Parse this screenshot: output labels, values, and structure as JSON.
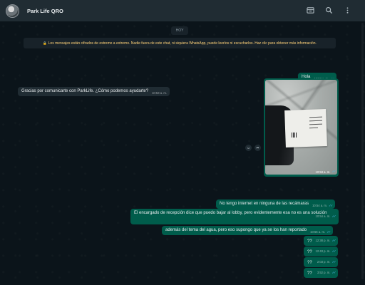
{
  "header": {
    "contact_name": "Park Life QRO",
    "icons": [
      "avatar",
      "catalog-icon",
      "search-icon",
      "menu-icon"
    ]
  },
  "chat": {
    "date_label": "HOY",
    "encryption_notice": "Los mensajes están cifrados de extremo a extremo. Nadie fuera de este chat, ni siquiera WhatsApp, puede leerlos ni escucharlos. Haz clic para obtener más información.",
    "messages": [
      {
        "direction": "out",
        "text": "Hola",
        "time": "10:53 a. m.",
        "status": "read"
      },
      {
        "direction": "in",
        "text": "Gracias por comunicarte con ParkLife. ¿Cómo podemos ayudarte?",
        "time": "10:53 a. m."
      },
      {
        "direction": "out",
        "type": "image",
        "text": "",
        "time": "10:53 a. m.",
        "status": "read"
      },
      {
        "direction": "out",
        "text": "No tengo internet en ninguna de las recámaras",
        "time": "10:54 a. m.",
        "status": "read"
      },
      {
        "direction": "out",
        "text": "El encargado de recepción dice que puedo bajar al lobby, pero evidentemente esa no es una solución",
        "time": "10:54 a. m.",
        "status": "read"
      },
      {
        "direction": "out",
        "text": "además del tema del agua, pero eso supongo que ya se los han reportado",
        "time": "10:56 a. m.",
        "status": "read"
      },
      {
        "direction": "out",
        "text": "??",
        "time": "12:38 p. m.",
        "status": "read"
      },
      {
        "direction": "out",
        "text": "??",
        "time": "12:43 p. m.",
        "status": "read"
      },
      {
        "direction": "out",
        "text": "??",
        "time": "2:03 p. m.",
        "status": "read"
      },
      {
        "direction": "out",
        "text": "??",
        "time": "3:52 p. m.",
        "status": "read"
      }
    ]
  },
  "colors": {
    "background": "#0b141a",
    "header": "#202c33",
    "outgoing_bubble": "#005c4b",
    "incoming_bubble": "#202c33",
    "notice_text": "#ffd279",
    "read_ticks": "#53bdeb"
  }
}
